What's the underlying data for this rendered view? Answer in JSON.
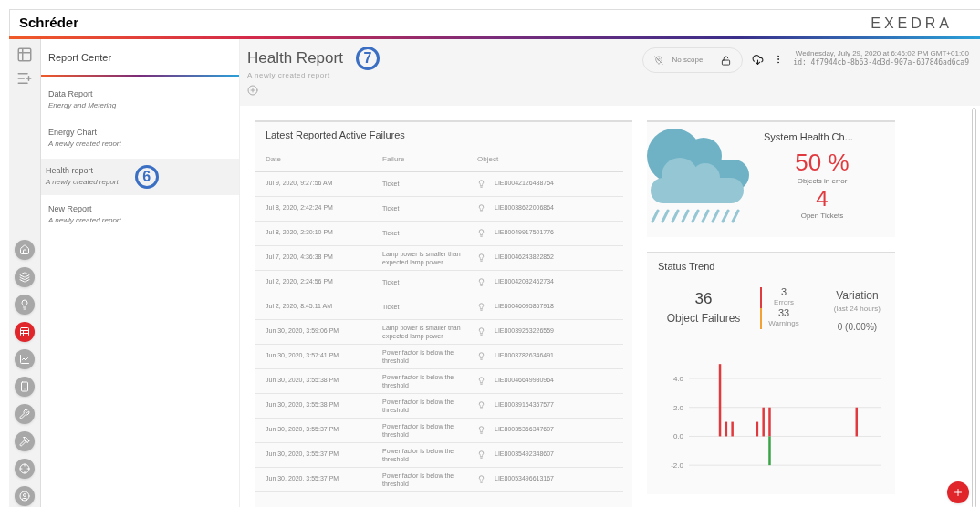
{
  "header": {
    "logo": "Schréder",
    "brand": "EXEDRA"
  },
  "rail": {
    "tools": [
      {
        "kind": "table"
      },
      {
        "kind": "add-list"
      }
    ],
    "nav": [
      {
        "kind": "home",
        "selected": false
      },
      {
        "kind": "layers",
        "selected": false
      },
      {
        "kind": "bulb",
        "selected": false
      },
      {
        "kind": "sheet",
        "selected": true
      },
      {
        "kind": "chart",
        "selected": false
      },
      {
        "kind": "device",
        "selected": false
      },
      {
        "kind": "wrench",
        "selected": false
      },
      {
        "kind": "hammer",
        "selected": false
      },
      {
        "kind": "crosshair",
        "selected": false
      },
      {
        "kind": "user",
        "selected": false
      }
    ]
  },
  "report_center": {
    "title": "Report Center",
    "items": [
      {
        "name": "Data Report",
        "description": "Energy and Metering",
        "selected": false
      },
      {
        "name": "Energy Chart",
        "description": "A newly created report",
        "selected": false
      },
      {
        "name": "Health report",
        "description": "A newly created report",
        "selected": true,
        "callout": "6"
      },
      {
        "name": "New Report",
        "description": "A newly created report",
        "selected": false
      }
    ]
  },
  "report": {
    "title": "Health Report",
    "callout": "7",
    "description": "A newly created report",
    "scope": "No scope",
    "timestamp": "Wednesday, July 29, 2020 at 6:46:02 PM GMT+01:00",
    "id": "id: 4f7944cb-8b63-4d3d-907a-637846ad6ca9"
  },
  "failures": {
    "title": "Latest Reported Active Failures",
    "columns": [
      "Date",
      "Failure",
      "Object"
    ],
    "rows": [
      {
        "date": "Jul 9, 2020, 9:27:56 AM",
        "failure": "Ticket",
        "object": "LIE80042126488754"
      },
      {
        "date": "Jul 8, 2020, 2:42:24 PM",
        "failure": "Ticket",
        "object": "LIE80038622006864"
      },
      {
        "date": "Jul 8, 2020, 2:30:10 PM",
        "failure": "Ticket",
        "object": "LIE80049917501776"
      },
      {
        "date": "Jul 7, 2020, 4:36:38 PM",
        "failure": "Lamp power is smaller than expected lamp power",
        "object": "LIE80046243822852"
      },
      {
        "date": "Jul 2, 2020, 2:24:56 PM",
        "failure": "Ticket",
        "object": "LIE80042032462734"
      },
      {
        "date": "Jul 2, 2020, 8:45:11 AM",
        "failure": "Ticket",
        "object": "LIE80046095867918"
      },
      {
        "date": "Jun 30, 2020, 3:59:06 PM",
        "failure": "Lamp power is smaller than expected lamp power",
        "object": "LIE80039253226559"
      },
      {
        "date": "Jun 30, 2020, 3:57:41 PM",
        "failure": "Power factor is below the threshold",
        "object": "LIE80037826346491"
      },
      {
        "date": "Jun 30, 2020, 3:55:38 PM",
        "failure": "Power factor is below the threshold",
        "object": "LIE80046649980964"
      },
      {
        "date": "Jun 30, 2020, 3:55:38 PM",
        "failure": "Power factor is below the threshold",
        "object": "LIE80039154357577"
      },
      {
        "date": "Jun 30, 2020, 3:55:37 PM",
        "failure": "Power factor is below the threshold",
        "object": "LIE80035366347607"
      },
      {
        "date": "Jun 30, 2020, 3:55:37 PM",
        "failure": "Power factor is below the threshold",
        "object": "LIE80035492348607"
      },
      {
        "date": "Jun 30, 2020, 3:55:37 PM",
        "failure": "Power factor is below the threshold",
        "object": "LIE80053496613167"
      }
    ]
  },
  "health": {
    "title": "System Health Ch...",
    "percent": "50 %",
    "percent_label": "Objects in error",
    "tickets": "4",
    "tickets_label": "Open Tickets"
  },
  "trend": {
    "title": "Status Trend",
    "total": "36",
    "total_label": "Object Failures",
    "counts": [
      {
        "value": "3",
        "label": "Errors",
        "color": "#e0393e"
      },
      {
        "value": "33",
        "label": "Warnings",
        "color": "#f5a033"
      }
    ],
    "variation": {
      "title": "Variation",
      "period": "(last 24 hours)",
      "value": "0 (0.00%)"
    },
    "chart": {
      "tick_labels": [
        "4.0",
        "2.0",
        "0.0",
        "-2.0"
      ]
    }
  }
}
